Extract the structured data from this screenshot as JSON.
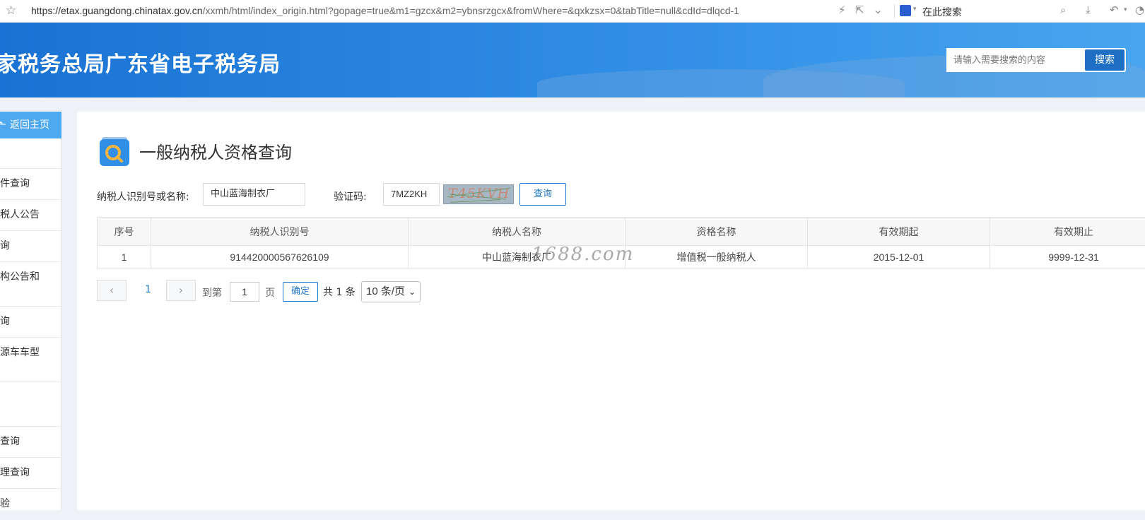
{
  "browser": {
    "url_main": "https://etax.guangdong.chinatax.gov.cn",
    "url_rest": "/xxmh/html/index_origin.html?gopage=true&m1=gzcx&m2=ybnsrzgcx&fromWhere=&qxkzsx=0&tabTitle=null&cdId=dlqcd-1",
    "search_engine_label": "在此搜索"
  },
  "header": {
    "site_title": "家税务总局广东省电子税务局",
    "search_placeholder": "请输入需要搜索的内容",
    "search_button": "搜索"
  },
  "sidebar": {
    "home_label": "返回主页",
    "items": [
      "件查询",
      "税人公告",
      "询",
      "构公告和",
      "询",
      "源车车型",
      "查询",
      "理查询",
      "验"
    ]
  },
  "page": {
    "title": "一般纳税人资格查询"
  },
  "form": {
    "taxpayer_label": "纳税人识别号或名称:",
    "taxpayer_value": "中山蓝海制衣厂",
    "captcha_label": "验证码:",
    "captcha_value": "7MZ2KH",
    "captcha_image_text": "T45KVH",
    "query_button": "查询"
  },
  "table": {
    "headers": [
      "序号",
      "纳税人识别号",
      "纳税人名称",
      "资格名称",
      "有效期起",
      "有效期止"
    ],
    "rows": [
      [
        "1",
        "914420000567626109",
        "中山蓝海制衣厂",
        "增值税一般纳税人",
        "2015-12-01",
        "9999-12-31"
      ]
    ]
  },
  "pagination": {
    "current_page": "1",
    "goto_label": "到第",
    "page_input": "1",
    "page_unit": "页",
    "confirm_button": "确定",
    "total_text": "共 1 条",
    "per_page": "10 条/页"
  },
  "watermark": "1688.com"
}
